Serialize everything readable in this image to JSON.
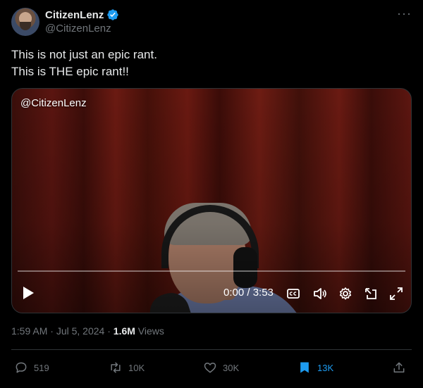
{
  "author": {
    "display_name": "CitizenLenz",
    "handle": "@CitizenLenz",
    "verified": true,
    "avatar_icon": "avatar-icon"
  },
  "more_icon_text": "···",
  "tweet": {
    "lines": [
      "This is not just an epic rant.",
      "This is THE epic rant!!"
    ]
  },
  "video": {
    "watermark": "@CitizenLenz",
    "timecode": "0:00 / 3:53",
    "progress": 0
  },
  "meta": {
    "time": "1:59 AM",
    "separator": "·",
    "date": "Jul 5, 2024",
    "views_count": "1.6M",
    "views_label": "Views"
  },
  "actions": {
    "replies": "519",
    "reposts": "10K",
    "likes": "30K",
    "bookmarks": "13K"
  },
  "colors": {
    "background": "#000000",
    "text": "#e7e9ea",
    "muted": "#71767b",
    "accent": "#1d9bf0",
    "border": "#2f3336"
  }
}
